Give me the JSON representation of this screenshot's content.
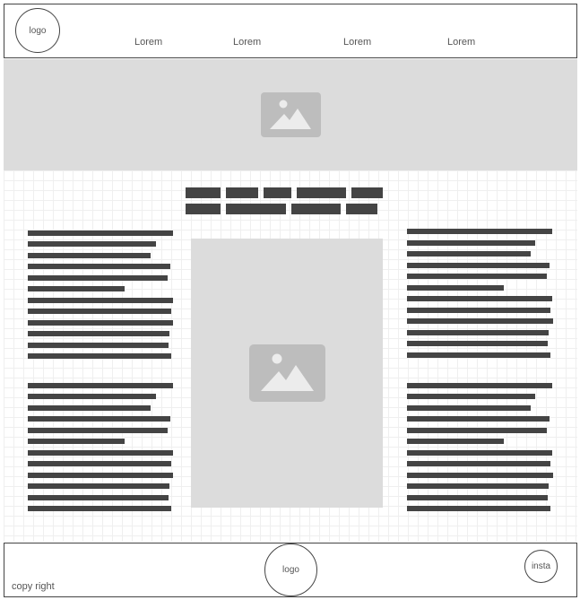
{
  "header": {
    "logo_text": "logo",
    "nav": [
      "Lorem",
      "Lorem",
      "Lorem",
      "Lorem"
    ]
  },
  "hero": {
    "image_icon": "image-placeholder-icon"
  },
  "content": {
    "center_image_icon": "image-placeholder-icon"
  },
  "footer": {
    "logo_text": "logo",
    "insta_text": "insta",
    "copyright_text": "copy right"
  },
  "colors": {
    "placeholder_bg": "#dcdcdc",
    "icon_gray": "#bdbdbd",
    "text_block": "#444444",
    "border": "#444444"
  }
}
